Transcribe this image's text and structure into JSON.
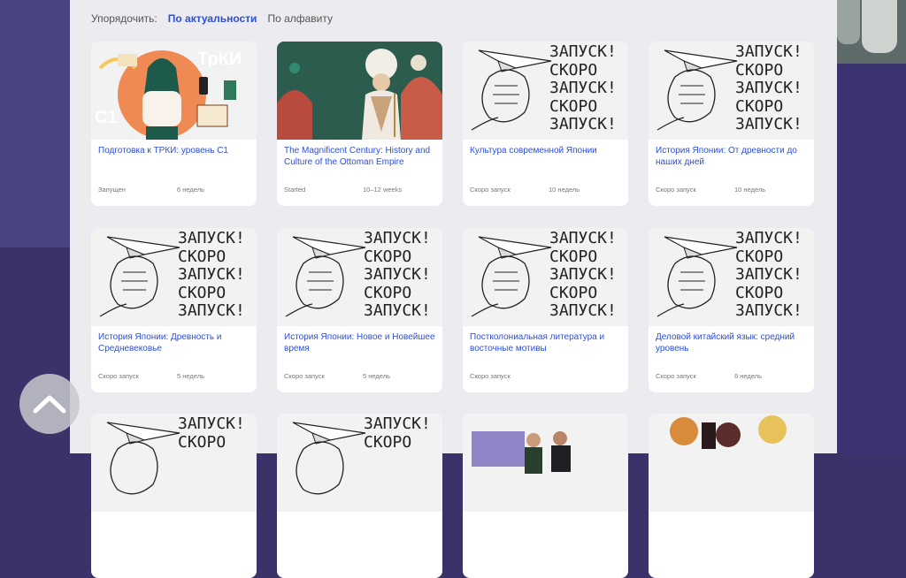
{
  "sort": {
    "label": "Упорядочить:",
    "options": [
      "По актуальности",
      "По алфавиту"
    ],
    "active": "По актуальности"
  },
  "placeholder_stamp": {
    "lines": [
      "ЗАПУСК!",
      "СКОРО",
      "ЗАПУСК!",
      "СКОРО",
      "ЗАПУСК!"
    ]
  },
  "art_text": {
    "trki": "ТрКИ",
    "c1": "С1"
  },
  "cards": [
    {
      "title": "Подготовка к ТРКИ: уровень С1",
      "status": "Запущен",
      "duration": "6 недель"
    },
    {
      "title": "The Magnificent Century: History and Culture of the Ottoman Empire",
      "status": "Started",
      "duration": "10–12 weeks"
    },
    {
      "title": "Культура современной Японии",
      "status": "Скоро запуск",
      "duration": "10 недель"
    },
    {
      "title": "История Японии: От древности до наших дней",
      "status": "Скоро запуск",
      "duration": "10 недель"
    },
    {
      "title": "История Японии: Древность и Средневековье",
      "status": "Скоро запуск",
      "duration": "5 недель"
    },
    {
      "title": "История Японии: Новое и Новейшее время",
      "status": "Скоро запуск",
      "duration": "5 недель"
    },
    {
      "title": "Постколониальная литература и восточные мотивы",
      "status": "Скоро запуск",
      "duration": ""
    },
    {
      "title": "Деловой китайский язык: средний уровень",
      "status": "Скоро запуск",
      "duration": "6 недель"
    }
  ],
  "colors": {
    "accent": "#2d4fd6",
    "panel": "#ececf0",
    "background": "#39336a"
  }
}
